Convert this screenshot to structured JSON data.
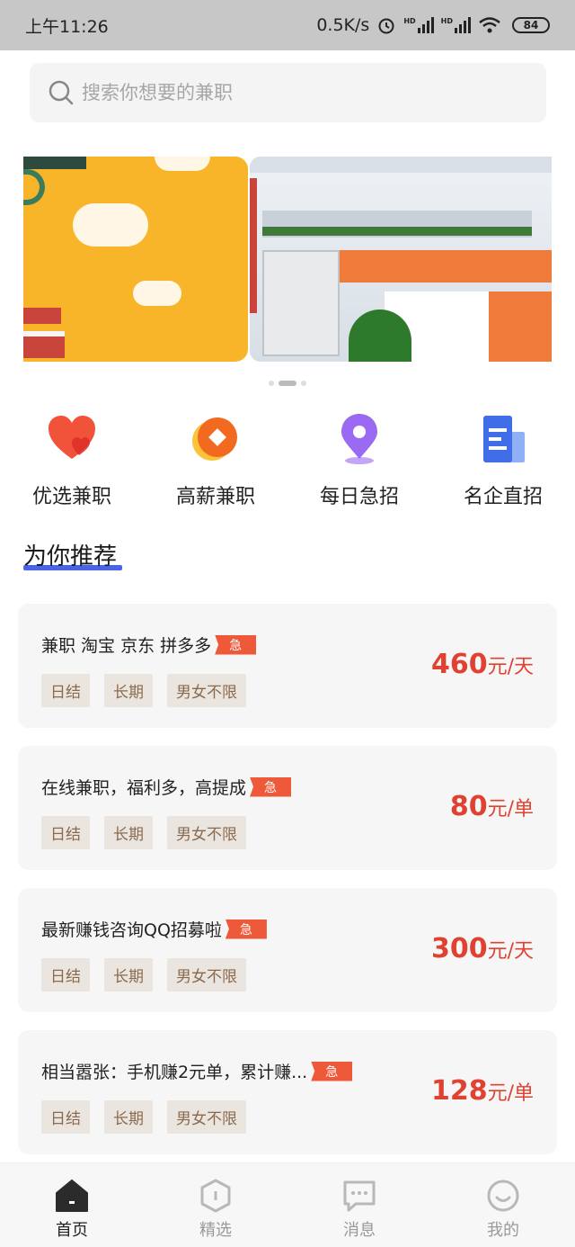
{
  "status_bar": {
    "time": "上午11:26",
    "speed": "0.5K/s",
    "battery": "84",
    "hd1": "HD",
    "hd2": "HD"
  },
  "search": {
    "placeholder": "搜索你想要的兼职"
  },
  "categories": [
    {
      "label": "优选兼职",
      "icon": "heart-icon",
      "color": "#f0523a"
    },
    {
      "label": "高薪兼职",
      "icon": "coin-icon",
      "color": "#f26a1f"
    },
    {
      "label": "每日急招",
      "icon": "location-pin-icon",
      "color": "#9b6af3"
    },
    {
      "label": "名企直招",
      "icon": "document-icon",
      "color": "#3f6ee8"
    }
  ],
  "section": {
    "title": "为你推荐"
  },
  "jobs": [
    {
      "title": "兼职 淘宝 京东 拼多多",
      "badge": "急",
      "tags": [
        "日结",
        "长期",
        "男女不限"
      ],
      "salary": "460",
      "unit": "元/天"
    },
    {
      "title": "在线兼职，福利多，高提成",
      "badge": "急",
      "tags": [
        "日结",
        "长期",
        "男女不限"
      ],
      "salary": "80",
      "unit": "元/单"
    },
    {
      "title": "最新赚钱咨询QQ招募啦",
      "badge": "急",
      "tags": [
        "日结",
        "长期",
        "男女不限"
      ],
      "salary": "300",
      "unit": "元/天"
    },
    {
      "title": "相当嚣张：手机赚2元单，累计赚...",
      "badge": "急",
      "tags": [
        "日结",
        "长期",
        "男女不限"
      ],
      "salary": "128",
      "unit": "元/单"
    }
  ],
  "tabbar": [
    {
      "label": "首页",
      "icon": "home-icon",
      "active": true
    },
    {
      "label": "精选",
      "icon": "hexagon-icon",
      "active": false
    },
    {
      "label": "消息",
      "icon": "message-icon",
      "active": false
    },
    {
      "label": "我的",
      "icon": "profile-icon",
      "active": false
    }
  ],
  "colors": {
    "accent_red": "#e04232",
    "urgent_badge": "#ee5a39",
    "underline_blue": "#4a63e7"
  }
}
